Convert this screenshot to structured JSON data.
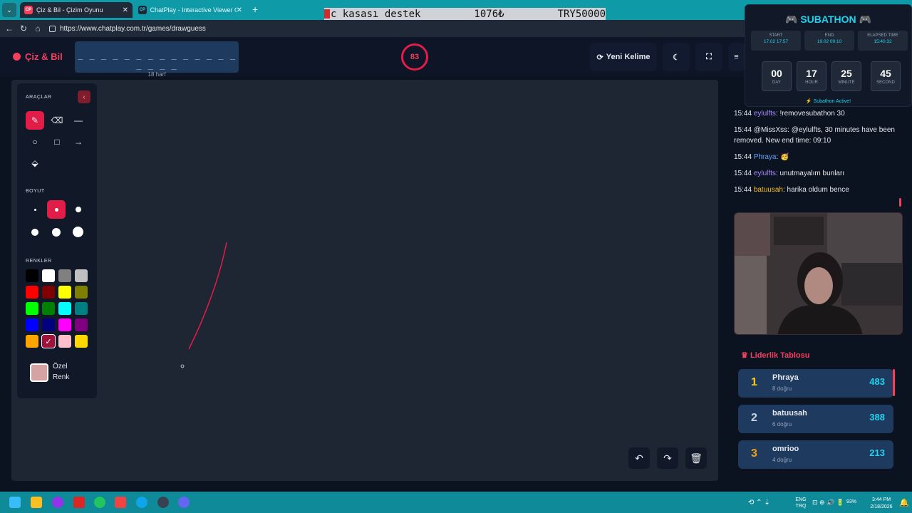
{
  "browser": {
    "tabs": [
      {
        "label": "Çiz & Bil - Çizim Oyunu",
        "favicon": "CP"
      },
      {
        "label": "ChatPlay - Interactive Viewer Gam",
        "favicon": "CP"
      }
    ],
    "url": "https://www.chatplay.com.tr/games/drawguess"
  },
  "stream_banner": {
    "text1": "c kasası destek",
    "amount": "1076₺",
    "goal": "TRY50000"
  },
  "app": {
    "logo": "Çiz & Bil",
    "word_mask": "_ _ _ _ _ _ _ _ _ _ _ _ _ _ _ _ _ _",
    "letter_count": "18 harf",
    "timer": "83",
    "new_word_label": "Yeni Kelime"
  },
  "toolbox": {
    "tools_label": "ARAÇLAR",
    "size_label": "BOYUT",
    "colors_label": "RENKLER",
    "custom_color_label": "Özel Renk",
    "colors": [
      "#000000",
      "#ffffff",
      "#808080",
      "#c0c0c0",
      "#ff0000",
      "#800000",
      "#ffff00",
      "#808000",
      "#00ff00",
      "#008000",
      "#00ffff",
      "#008080",
      "#0000ff",
      "#000080",
      "#ff00ff",
      "#800080",
      "#ffa500",
      "#a52a2a",
      "#ffc0cb",
      "#ffd700"
    ]
  },
  "chat": {
    "messages": [
      {
        "time": "15:44",
        "user": "eylulfts",
        "text": ": !removesubathon 30",
        "color": "#a78bfa"
      },
      {
        "time": "15:44",
        "user": "",
        "text": "@MissXss: @eylulfts, 30 minutes have been removed. New end time: 09:10",
        "color": "#e5e7eb"
      },
      {
        "time": "15:44",
        "user": "Phraya",
        "text": ": 🥳",
        "color": "#60a5fa"
      },
      {
        "time": "15:44",
        "user": "eylulfts",
        "text": ": unutmayalım bunları",
        "color": "#a78bfa"
      },
      {
        "time": "15:44",
        "user": "batuusah",
        "text": ": harika oldum bence",
        "color": "#fbbf24"
      }
    ]
  },
  "leaderboard": {
    "title": "Liderlik Tablosu",
    "rows": [
      {
        "rank": "1",
        "name": "Phraya",
        "sub": "8 doğru",
        "score": "483",
        "rank_color": "#facc15"
      },
      {
        "rank": "2",
        "name": "batuusah",
        "sub": "6 doğru",
        "score": "388",
        "rank_color": "#cbd5e1"
      },
      {
        "rank": "3",
        "name": "omrioo",
        "sub": "4 doğru",
        "score": "213",
        "rank_color": "#f59e0b"
      }
    ]
  },
  "subathon": {
    "title": "SUBATHON",
    "start_label": "START",
    "start_value": "17.02 17:57",
    "end_label": "END",
    "end_value": "19.02 09:10",
    "elapsed_label": "ELAPSED TIME",
    "elapsed_value": "15:40:32",
    "countdown": [
      {
        "n": "00",
        "u": "DAY"
      },
      {
        "n": "17",
        "u": "HOUR"
      },
      {
        "n": "25",
        "u": "MINUTE"
      },
      {
        "n": "45",
        "u": "SECOND"
      }
    ],
    "status": "Subathon Active!"
  },
  "taskbar": {
    "lang1": "ENG",
    "lang2": "TRQ",
    "battery": "93%",
    "time": "3:44 PM",
    "date": "2/18/2026"
  }
}
